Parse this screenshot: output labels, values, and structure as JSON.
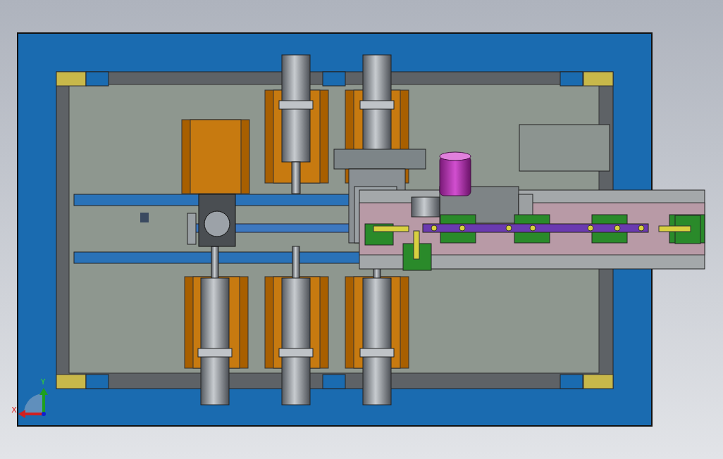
{
  "axis_triad": {
    "x_label": "X",
    "y_label": "Y"
  }
}
